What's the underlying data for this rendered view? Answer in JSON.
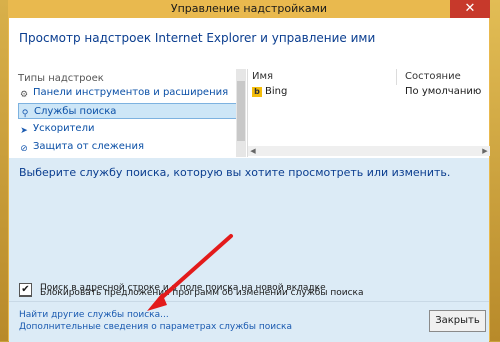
{
  "window": {
    "title": "Управление надстройками",
    "close_glyph": "✕"
  },
  "header": {
    "title": "Просмотр надстроек Internet Explorer и управление ими"
  },
  "types": {
    "label": "Типы надстроек",
    "items": [
      {
        "label": "Панели инструментов и расширения",
        "icon": "toolbar-gear-icon",
        "selected": false
      },
      {
        "label": "Службы поиска",
        "icon": "search-icon",
        "selected": true
      },
      {
        "label": "Ускорители",
        "icon": "accelerator-icon",
        "selected": false
      },
      {
        "label": "Защита от слежения",
        "icon": "tracking-protection-icon",
        "selected": false
      }
    ]
  },
  "list": {
    "columns": [
      "Имя",
      "Состояние"
    ],
    "rows": [
      {
        "name": "Bing",
        "state": "По умолчанию"
      }
    ]
  },
  "details": {
    "prompt": "Выберите службу поиска, которую вы хотите просмотреть или изменить.",
    "checkbox1": {
      "label": "Блокировать предложения программ об изменении службы поиска",
      "checked": false
    },
    "checkbox2": {
      "label": "Поиск в адресной строке и в поле поиска на новой вкладке",
      "checked": true
    }
  },
  "footer": {
    "link1": "Найти другие службы поиска...",
    "link2": "Дополнительные сведения о параметрах службы поиска",
    "close_label": "Закрыть"
  },
  "colors": {
    "accent": "#1a5ab0",
    "arrow": "#e31b1b",
    "title_bg": "#e9b94e"
  }
}
